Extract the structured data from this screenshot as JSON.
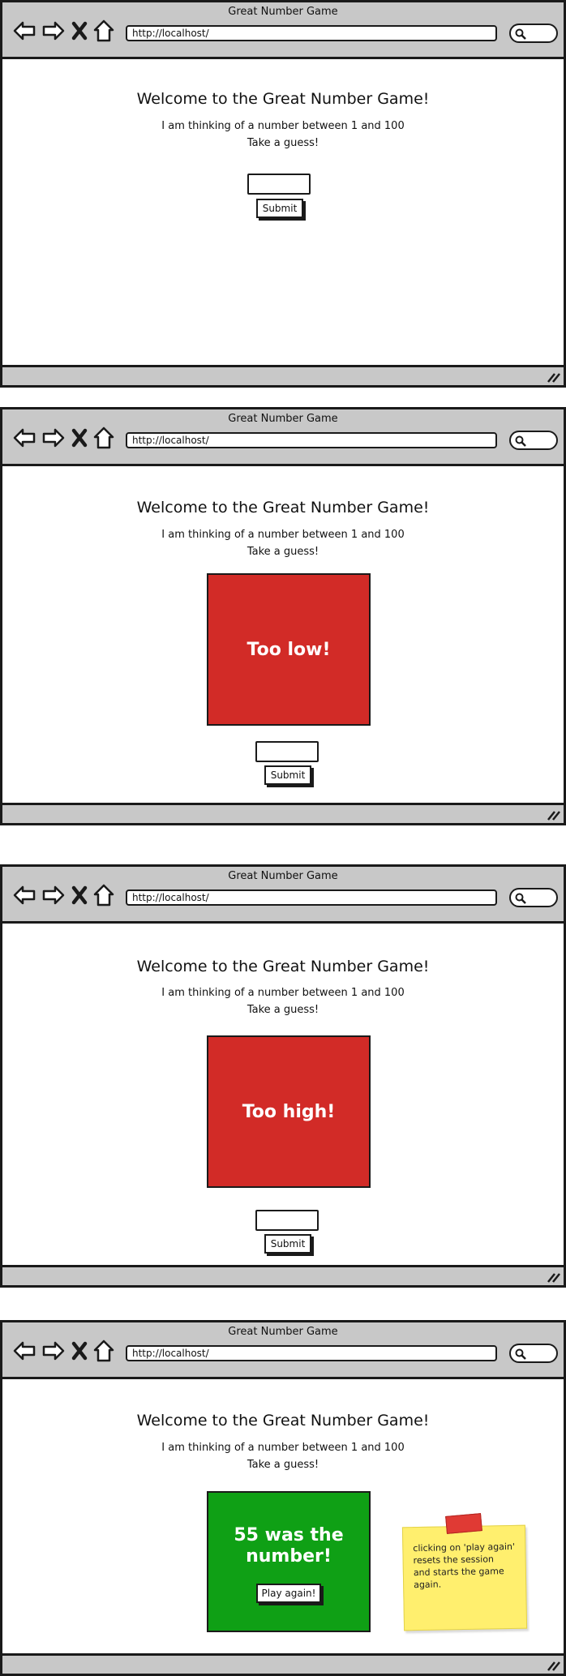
{
  "browser": {
    "window_title": "Great Number Game",
    "url": "http://localhost/"
  },
  "page": {
    "heading": "Welcome to the Great Number Game!",
    "line1": "I am thinking of a number between 1 and 100",
    "line2": "Take a guess!",
    "submit_label": "Submit"
  },
  "screens": {
    "too_low": "Too low!",
    "too_high": "Too high!",
    "win_line1": "55 was the",
    "win_line2": "number!",
    "play_again_label": "Play again!"
  },
  "note": {
    "line1": "clicking on 'play again'",
    "line2": "resets the session",
    "line3": "and starts the game",
    "line4": "again."
  },
  "colors": {
    "chrome": "#c8c8c8",
    "wrong": "#d22b27",
    "correct": "#0fa015",
    "note": "#ffef6e",
    "tape": "#e03a34"
  }
}
